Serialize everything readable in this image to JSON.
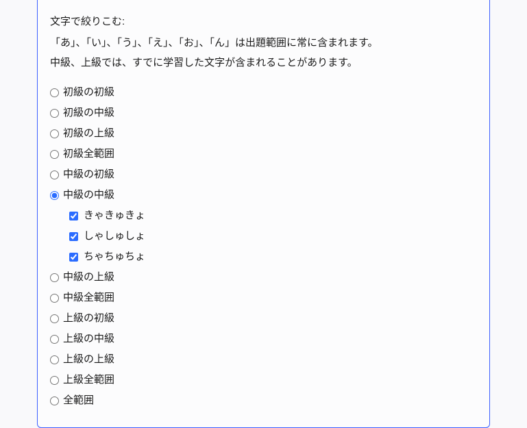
{
  "filter": {
    "label": "文字で絞りこむ:",
    "note_line1": "「あ」、「い」、「う」、「え」、「お」、「ん」は出題範囲に常に含まれます。",
    "note_line2": "中級、上級では、すでに学習した文字が含まれることがあります。",
    "options": {
      "opt0": "初級の初級",
      "opt1": "初級の中級",
      "opt2": "初級の上級",
      "opt3": "初級全範囲",
      "opt4": "中級の初級",
      "opt5": "中級の中級",
      "opt6": "中級の上級",
      "opt7": "中級全範囲",
      "opt8": "上級の初級",
      "opt9": "上級の中級",
      "opt10": "上級の上級",
      "opt11": "上級全範囲",
      "opt12": "全範囲"
    },
    "sub_options": {
      "sub0": "きゃきゅきょ",
      "sub1": "しゃしゅしょ",
      "sub2": "ちゃちゅちょ"
    },
    "selected_index": 5
  }
}
